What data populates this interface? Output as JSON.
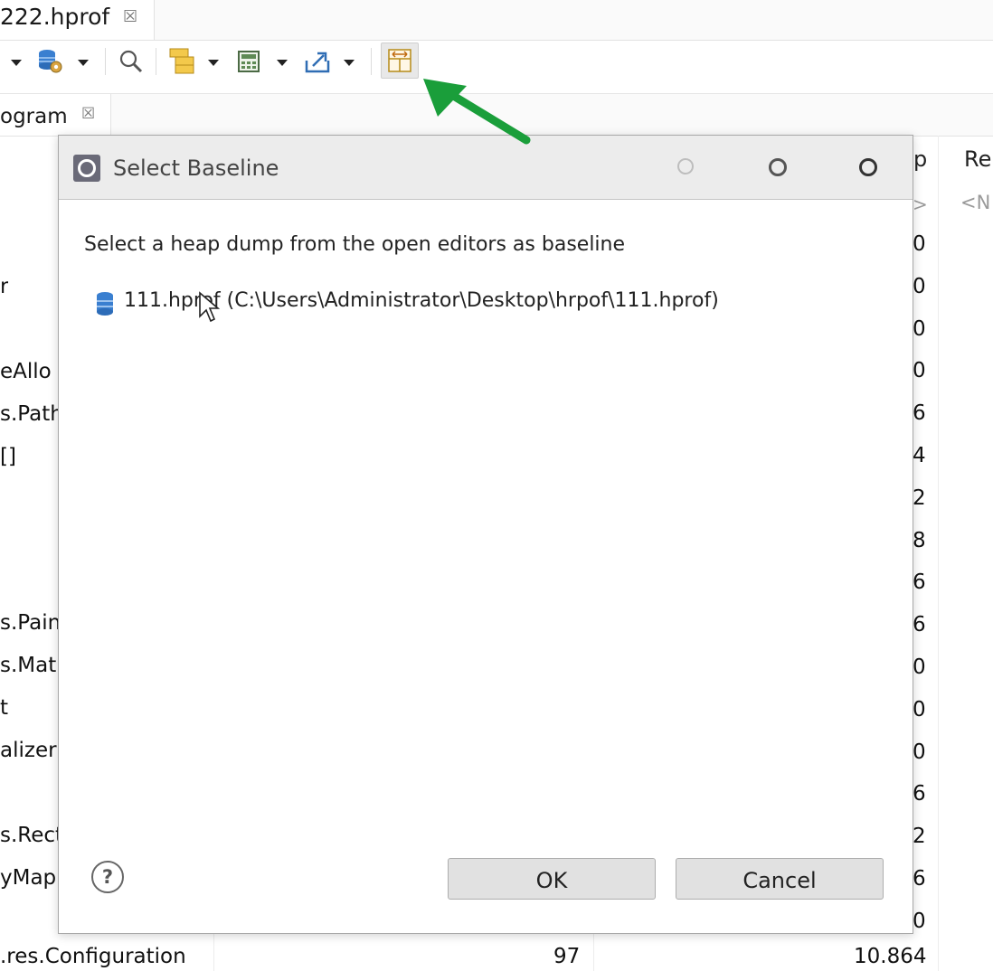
{
  "editor_tab": {
    "label": "222.hprof",
    "close": "☒"
  },
  "view_tab": {
    "label": "ogram",
    "close": "☒"
  },
  "background_table": {
    "header_partial": "p",
    "header_retained": "Re",
    "header_row_right": "<N",
    "header_row_mid": ">",
    "left_col": [
      "r",
      "eAllo",
      "s.Path",
      "[]",
      "s.Pain",
      "s.Mat",
      "t",
      "alizerF",
      "s.Rect",
      "yMap"
    ],
    "right_col": [
      "0",
      "0",
      "0",
      "0",
      "6",
      "4",
      "2",
      "8",
      "6",
      "6",
      "0",
      "0",
      "0",
      "6",
      "2",
      "6",
      "0"
    ],
    "last_row_class": ".res.Configuration",
    "last_row_objects": "97",
    "last_row_shallow": "10.864"
  },
  "dialog": {
    "title": "Select Baseline",
    "message": "Select a heap dump from the open editors as baseline",
    "items": [
      {
        "label": "111.hprof (C:\\Users\\Administrator\\Desktop\\hrpof\\111.hprof)"
      }
    ],
    "help_glyph": "?",
    "ok_label": "OK",
    "cancel_label": "Cancel"
  },
  "colors": {
    "arrow": "#1a9e3a",
    "title_bar": "#ececec",
    "button": "#e1e1e1"
  }
}
